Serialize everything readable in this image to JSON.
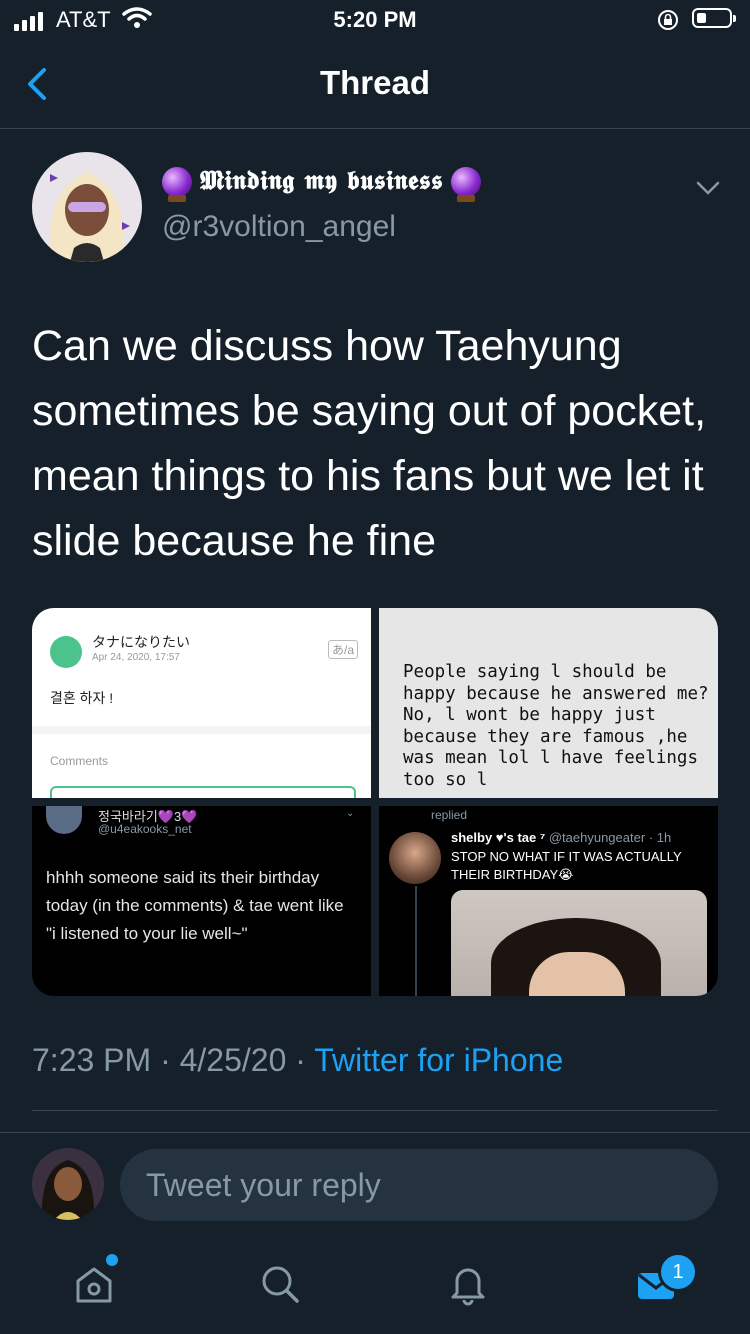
{
  "status_bar": {
    "carrier": "AT&T",
    "time": "5:20 PM"
  },
  "nav": {
    "title": "Thread"
  },
  "tweet": {
    "display_name": "𝕸𝖎𝖓𝖉𝖎𝖓𝖌 𝖒𝖞 𝖇𝖚𝖘𝖎𝖓𝖊𝖘𝖘",
    "handle": "@r3voltion_angel",
    "text": "Can we discuss how Taehyung sometimes be saying out of pocket, mean things to his fans but we let it slide because he fine",
    "time": "7:23 PM",
    "date": "4/25/20",
    "source": "Twitter for iPhone"
  },
  "media": {
    "image1": {
      "name": "タナになりたい",
      "date": "Apr 24, 2020, 17:57",
      "body": "결혼 하자 !",
      "comments_label": "Comments",
      "translate": "あ/a"
    },
    "image2": {
      "text": "People saying l should be happy because he answered me?No, l wont be happy just because they are famous ,he was mean lol l have feelings too so l"
    },
    "image3": {
      "name": "정국바라기💜3💜",
      "handle": "@u4eakooks_net",
      "text": "hhhh someone said its their birthday today (in the comments) & tae went like \"i listened to your lie well~\""
    },
    "image4": {
      "replied": "replied",
      "name": "shelby ♥'s tae ⁷",
      "handle_time": "@taehyungeater · 1h",
      "text": "STOP NO WHAT IF IT WAS ACTUALLY THEIR BIRTHDAY😭"
    }
  },
  "reply": {
    "placeholder": "Tweet your reply"
  },
  "tab_bar": {
    "messages_badge": "1"
  },
  "colors": {
    "background": "#15202b",
    "accent": "#1da1f2",
    "secondary_text": "#8899a6",
    "divider": "#38444d"
  }
}
